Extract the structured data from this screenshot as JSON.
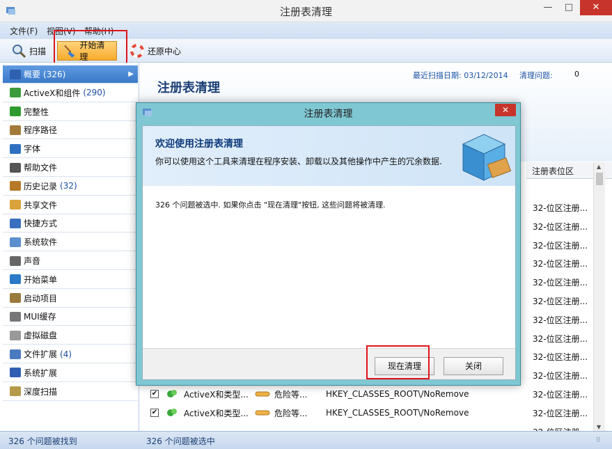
{
  "window": {
    "title": "注册表清理",
    "minimize": "—",
    "maximize": "□",
    "close": "✕"
  },
  "menu": [
    "文件(F)",
    "视图(V)",
    "帮助(H)"
  ],
  "toolbar": {
    "scan": "扫描",
    "start_clean": "开始清理",
    "restore_center": "还原中心"
  },
  "sidebar": [
    {
      "label": "概要",
      "count": "(326)",
      "color": "#2f5fb0"
    },
    {
      "label": "ActiveX和组件",
      "count": "(290)",
      "color": "#3c9b3c"
    },
    {
      "label": "完整性",
      "count": "",
      "color": "#2f9b2f"
    },
    {
      "label": "程序路径",
      "count": "",
      "color": "#a47a3a"
    },
    {
      "label": "字体",
      "count": "",
      "color": "#2f6fc0"
    },
    {
      "label": "帮助文件",
      "count": "",
      "color": "#555555"
    },
    {
      "label": "历史记录",
      "count": "(32)",
      "color": "#b77a2a"
    },
    {
      "label": "共享文件",
      "count": "",
      "color": "#d9a23a"
    },
    {
      "label": "快捷方式",
      "count": "",
      "color": "#3a6fc0"
    },
    {
      "label": "系统软件",
      "count": "",
      "color": "#5c8fcf"
    },
    {
      "label": "声音",
      "count": "",
      "color": "#666666"
    },
    {
      "label": "开始菜单",
      "count": "",
      "color": "#2a7ac9"
    },
    {
      "label": "启动项目",
      "count": "",
      "color": "#9a7a3a"
    },
    {
      "label": "MUI缓存",
      "count": "",
      "color": "#777777"
    },
    {
      "label": "虚拟磁盘",
      "count": "",
      "color": "#999999"
    },
    {
      "label": "文件扩展",
      "count": "(4)",
      "color": "#4a7ac0"
    },
    {
      "label": "系统扩展",
      "count": "",
      "color": "#2f5fb0"
    },
    {
      "label": "深度扫描",
      "count": "",
      "color": "#b59a4a"
    }
  ],
  "main": {
    "title": "注册表清理",
    "last_scan_label": "最近扫描日期: 03/12/2014",
    "issues_label": "清理问题:",
    "issues_value": "0",
    "column_registry": "注册表位区",
    "right_cells": [
      "32-位区注册...",
      "32-位区注册...",
      "32-位区注册...",
      "32-位区注册...",
      "32-位区注册...",
      "32-位区注册...",
      "32-位区注册...",
      "32-位区注册...",
      "32-位区注册...",
      "32-位区注册...",
      "32-位区注册...",
      "32-位区注册...",
      "32-位区注册..."
    ],
    "rows": [
      {
        "check": "✔",
        "name": "ActiveX和类型...",
        "risk": "危险等...",
        "key": "HKEY_CLASSES_ROOT\\/NoRemove"
      },
      {
        "check": "✔",
        "name": "ActiveX和类型...",
        "risk": "危险等...",
        "key": "HKEY_CLASSES_ROOT\\/NoRemove"
      }
    ]
  },
  "status": {
    "left": "326 个问题被找到",
    "right": "326 个问题被选中"
  },
  "dialog": {
    "title": "注册表清理",
    "heading": "欢迎使用注册表清理",
    "description": "你可以使用这个工具来清理在程序安装、卸载以及其他操作中产生的冗余数据.",
    "message": "326 个问题被选中. 如果你点击 \"现在清理\"按钮, 这些问题将被清理.",
    "clean_now": "现在清理",
    "close_btn": "关闭",
    "close_x": "✕"
  },
  "colors": {
    "accent_red": "#e0121a",
    "selected_blue": "#3a79c9",
    "dialog_frame": "#7fc8d3"
  }
}
